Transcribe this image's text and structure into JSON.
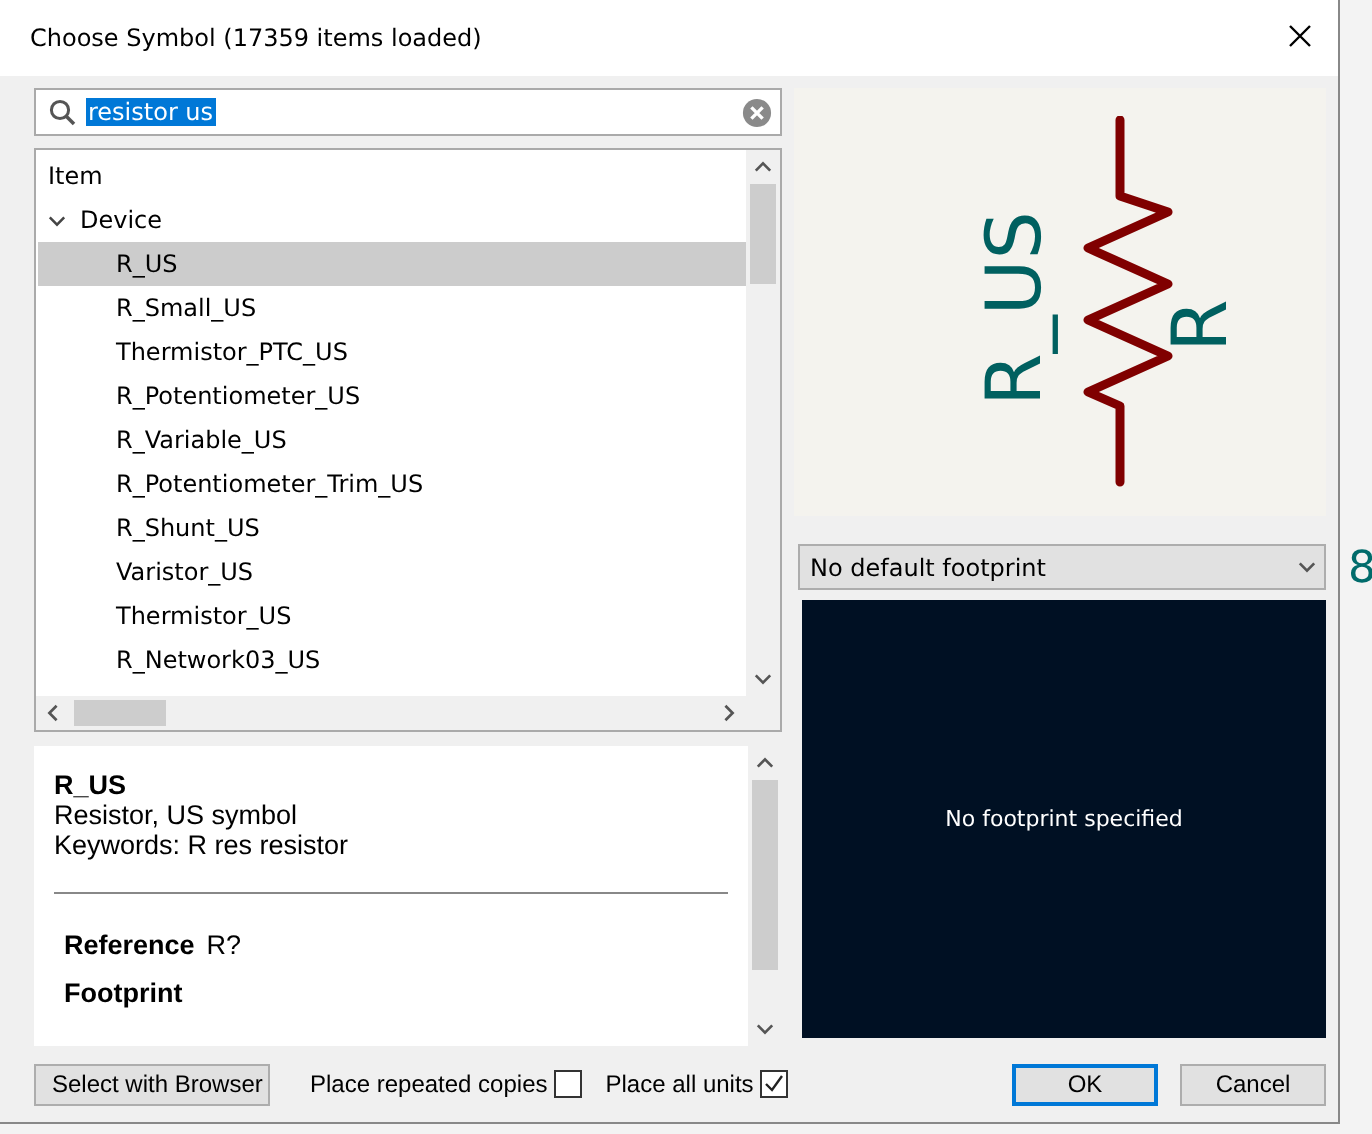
{
  "window": {
    "title": "Choose Symbol (17359 items loaded)"
  },
  "search": {
    "value": "resistor us",
    "text_selected": true
  },
  "tree": {
    "header": "Item",
    "groups": [
      {
        "label": "Device",
        "expanded": true,
        "children": [
          {
            "label": "R_US",
            "selected": true
          },
          {
            "label": "R_Small_US",
            "selected": false
          },
          {
            "label": "Thermistor_PTC_US",
            "selected": false
          },
          {
            "label": "R_Potentiometer_US",
            "selected": false
          },
          {
            "label": "R_Variable_US",
            "selected": false
          },
          {
            "label": "R_Potentiometer_Trim_US",
            "selected": false
          },
          {
            "label": "R_Shunt_US",
            "selected": false
          },
          {
            "label": "Varistor_US",
            "selected": false
          },
          {
            "label": "Thermistor_US",
            "selected": false
          },
          {
            "label": "R_Network03_US",
            "selected": false
          }
        ]
      }
    ]
  },
  "details": {
    "name": "R_US",
    "description": "Resistor, US symbol",
    "keywords": "Keywords: R res resistor",
    "fields": [
      {
        "label": "Reference",
        "value": "R?"
      },
      {
        "label": "Footprint"
      }
    ]
  },
  "preview": {
    "value_text": "R_US",
    "reference_text": "R"
  },
  "footprint_select": {
    "value": "No default footprint"
  },
  "footprint_preview": {
    "message": "No footprint specified"
  },
  "background_fragment": "8",
  "options": [
    {
      "label": "Place repeated copies",
      "checked": false
    },
    {
      "label": "Place all units",
      "checked": true
    }
  ],
  "buttons": {
    "browser": "Select with Browser",
    "ok": "OK",
    "cancel": "Cancel"
  }
}
